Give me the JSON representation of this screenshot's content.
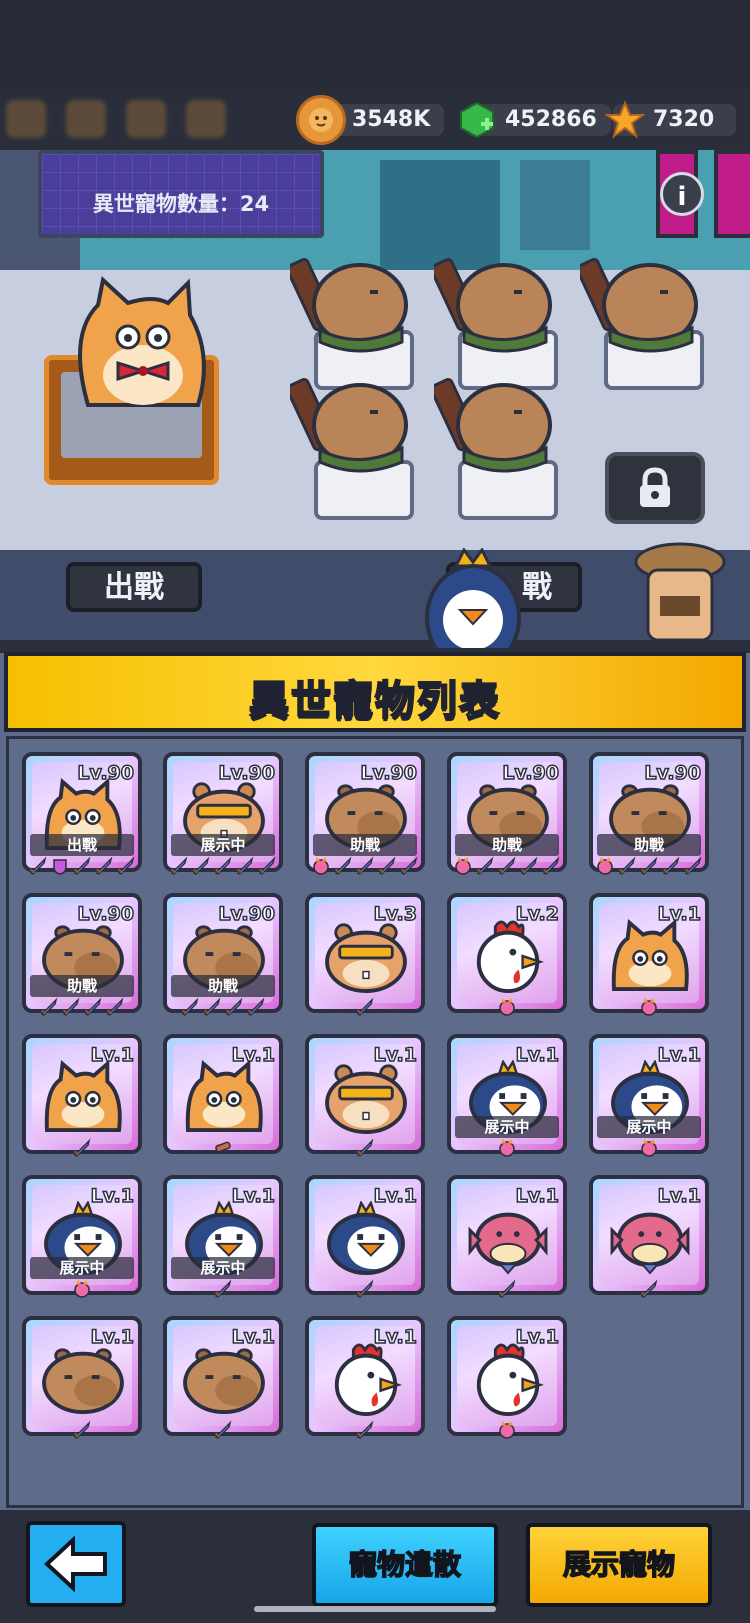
{
  "resources": [
    {
      "icon": "bread-coin-icon",
      "value": "3548K",
      "color": "#e8963a"
    },
    {
      "icon": "green-gem-icon",
      "value": "452866",
      "color": "#36b84a"
    },
    {
      "icon": "star-icon",
      "value": "7320",
      "color": "#f4a62a"
    }
  ],
  "scene": {
    "pet_count_label": "異世寵物數量：24",
    "deploy_plate": "出戰",
    "second_plate": "戰",
    "info_icon": "i"
  },
  "panel": {
    "title": "異世寵物列表"
  },
  "cards": [
    {
      "pet": "cat",
      "lv": "Lv.90",
      "status": "出戰",
      "gear": [
        "sword",
        "shield-pink",
        "sword",
        "sword",
        "sword"
      ]
    },
    {
      "pet": "hamster",
      "lv": "Lv.90",
      "status": "展示中",
      "gear": [
        "sword",
        "sword",
        "sword",
        "sword",
        "sword"
      ]
    },
    {
      "pet": "capybara",
      "lv": "Lv.90",
      "status": "助戰",
      "gear": [
        "cat-badge",
        "sword",
        "sword",
        "sword",
        "sword"
      ]
    },
    {
      "pet": "capybara",
      "lv": "Lv.90",
      "status": "助戰",
      "gear": [
        "cat-badge",
        "sword",
        "sword",
        "sword",
        "sword"
      ]
    },
    {
      "pet": "capybara",
      "lv": "Lv.90",
      "status": "助戰",
      "gear": [
        "cat-badge",
        "sword",
        "sword",
        "sword",
        "sword"
      ]
    },
    {
      "pet": "capybara",
      "lv": "Lv.90",
      "status": "助戰",
      "gear": [
        "sword",
        "sword",
        "sword",
        "sword"
      ]
    },
    {
      "pet": "capybara",
      "lv": "Lv.90",
      "status": "助戰",
      "gear": [
        "sword",
        "sword",
        "sword",
        "sword"
      ]
    },
    {
      "pet": "hamster",
      "lv": "Lv.3",
      "status": "",
      "gear": [
        "sword"
      ]
    },
    {
      "pet": "rooster",
      "lv": "Lv.2",
      "status": "",
      "gear": [
        "cat-badge"
      ]
    },
    {
      "pet": "cat",
      "lv": "Lv.1",
      "status": "",
      "gear": [
        "cat-badge"
      ]
    },
    {
      "pet": "cat",
      "lv": "Lv.1",
      "status": "",
      "gear": [
        "sword"
      ]
    },
    {
      "pet": "cat",
      "lv": "Lv.1",
      "status": "",
      "gear": [
        "club"
      ]
    },
    {
      "pet": "hamster",
      "lv": "Lv.1",
      "status": "",
      "gear": [
        "sword"
      ]
    },
    {
      "pet": "penguin",
      "lv": "Lv.1",
      "status": "展示中",
      "gear": [
        "cat-badge"
      ]
    },
    {
      "pet": "penguin",
      "lv": "Lv.1",
      "status": "展示中",
      "gear": [
        "cat-badge"
      ]
    },
    {
      "pet": "penguin",
      "lv": "Lv.1",
      "status": "展示中",
      "gear": [
        "cat-badge"
      ]
    },
    {
      "pet": "penguin",
      "lv": "Lv.1",
      "status": "展示中",
      "gear": [
        "sword"
      ]
    },
    {
      "pet": "penguin",
      "lv": "Lv.1",
      "status": "",
      "gear": [
        "sword"
      ]
    },
    {
      "pet": "pufferfish",
      "lv": "Lv.1",
      "status": "",
      "gear": [
        "sword"
      ]
    },
    {
      "pet": "pufferfish",
      "lv": "Lv.1",
      "status": "",
      "gear": [
        "sword"
      ]
    },
    {
      "pet": "capybara",
      "lv": "Lv.1",
      "status": "",
      "gear": [
        "sword"
      ]
    },
    {
      "pet": "capybara",
      "lv": "Lv.1",
      "status": "",
      "gear": [
        "sword"
      ]
    },
    {
      "pet": "rooster",
      "lv": "Lv.1",
      "status": "",
      "gear": [
        "sword"
      ]
    },
    {
      "pet": "rooster",
      "lv": "Lv.1",
      "status": "",
      "gear": [
        "cat-badge"
      ]
    }
  ],
  "bottom": {
    "release_label": "寵物遣散",
    "show_label": "展示寵物",
    "back_icon": "back-arrow-icon"
  }
}
